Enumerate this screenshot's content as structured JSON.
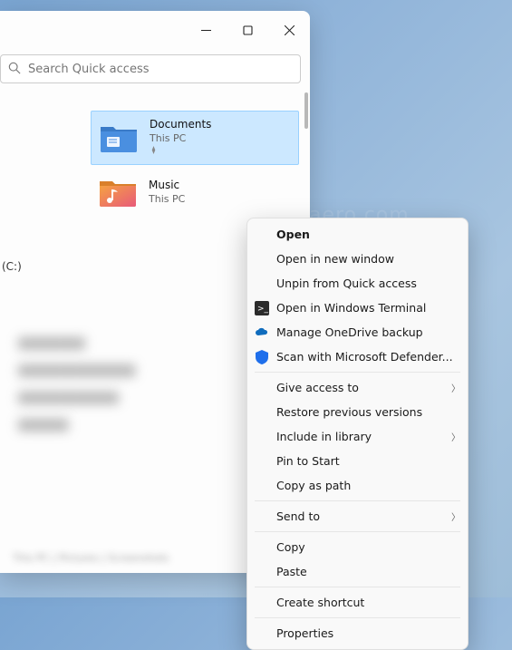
{
  "search": {
    "placeholder": "Search Quick access"
  },
  "items": [
    {
      "title": "Documents",
      "sub": "This PC",
      "pin": "📌"
    },
    {
      "title": "Music",
      "sub": "This PC"
    }
  ],
  "sidebar_drive": "(C:)",
  "menu": {
    "open": "Open",
    "open_new": "Open in new window",
    "unpin": "Unpin from Quick access",
    "terminal": "Open in Windows Terminal",
    "onedrive": "Manage OneDrive backup",
    "defender": "Scan with Microsoft Defender...",
    "give_access": "Give access to",
    "restore": "Restore previous versions",
    "include": "Include in library",
    "pin_start": "Pin to Start",
    "copy_path": "Copy as path",
    "send_to": "Send to",
    "copy": "Copy",
    "paste": "Paste",
    "shortcut": "Create shortcut",
    "properties": "Properties"
  },
  "watermark": "winaero.com",
  "footer": "This PC | Pictures | Screenshots"
}
